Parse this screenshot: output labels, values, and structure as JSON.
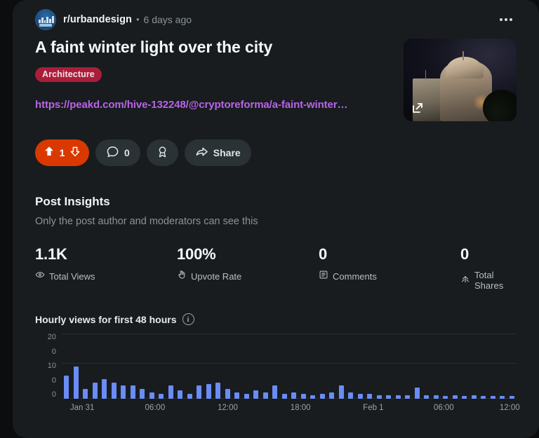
{
  "post": {
    "subreddit": "r/urbandesign",
    "separator": "•",
    "timestamp": "6 days ago",
    "title": "A faint winter light over the city",
    "flair": "Architecture",
    "link": "https://peakd.com/hive-132248/@cryptoreforma/a-faint-winter…",
    "thumbnail_alt": "night photo of domed building"
  },
  "actions": {
    "vote_count": "1",
    "comment_count": "0",
    "share_label": "Share",
    "award_label": "award"
  },
  "insights": {
    "heading": "Post Insights",
    "subheading": "Only the post author and moderators can see this",
    "stats": [
      {
        "value": "1.1K",
        "label": "Total Views",
        "icon": "eye-icon"
      },
      {
        "value": "100%",
        "label": "Upvote Rate",
        "icon": "hand-icon"
      },
      {
        "value": "0",
        "label": "Comments",
        "icon": "comment-box-icon"
      },
      {
        "value": "0",
        "label": "Total Shares",
        "icon": "share-arrow-icon"
      }
    ]
  },
  "chart_section": {
    "title": "Hourly views for first 48 hours",
    "info_glyph": "i"
  },
  "chart_data": {
    "type": "bar",
    "title": "Hourly views for first 48 hours",
    "xlabel": "",
    "ylabel": "",
    "ylim": [
      0,
      20
    ],
    "grid": true,
    "legend": null,
    "y_ticks": [
      "20",
      "0",
      "10",
      "0",
      "0"
    ],
    "x_ticks": [
      "Jan 31",
      "06:00",
      "12:00",
      "18:00",
      "Feb 1",
      "06:00",
      "12:00"
    ],
    "x_tick_positions_pct": [
      4.5,
      20.5,
      36.5,
      52.5,
      68.5,
      84.0,
      98.5
    ],
    "bar_color": "#6a8cf5",
    "categories": [
      "0",
      "1",
      "2",
      "3",
      "4",
      "5",
      "6",
      "7",
      "8",
      "9",
      "10",
      "11",
      "12",
      "13",
      "14",
      "15",
      "16",
      "17",
      "18",
      "19",
      "20",
      "21",
      "22",
      "23",
      "24",
      "25",
      "26",
      "27",
      "28",
      "29",
      "30",
      "31",
      "32",
      "33",
      "34",
      "35",
      "36",
      "37",
      "38",
      "39",
      "40",
      "41",
      "42",
      "43",
      "44",
      "45",
      "46",
      "47"
    ],
    "values": [
      7,
      10,
      3,
      5,
      6,
      5,
      4,
      4,
      3,
      2,
      1.5,
      4,
      2.5,
      1.5,
      4,
      4.5,
      5,
      3,
      2,
      1.5,
      2.5,
      2,
      4,
      1.5,
      2,
      1.5,
      1,
      1.5,
      2,
      4,
      2,
      1.5,
      1.5,
      1,
      1,
      1,
      1,
      3.5,
      1,
      1,
      0.8,
      1,
      0.8,
      1,
      0.8,
      0.8,
      0.8,
      0.8
    ]
  },
  "colors": {
    "page_background": "#0b0d0f",
    "card_background": "#181c1f",
    "upvote_pill": "#d93900",
    "flair_background": "#aa1e3a",
    "link": "#b964e8",
    "bar": "#6a8cf5"
  }
}
